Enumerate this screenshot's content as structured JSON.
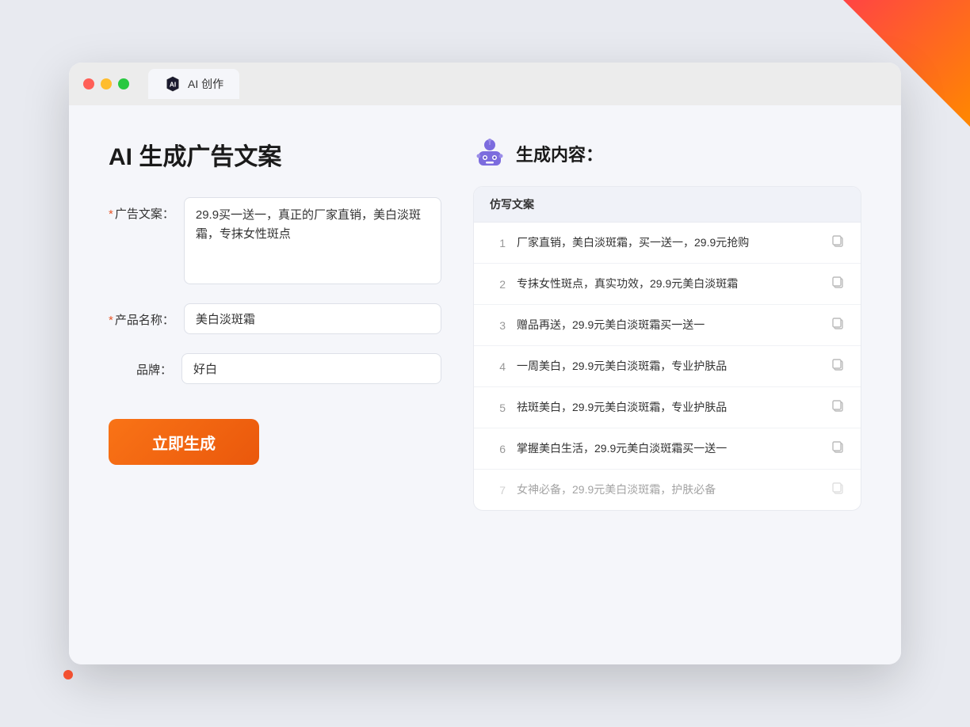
{
  "browser": {
    "tab_label": "AI 创作"
  },
  "page": {
    "title": "AI 生成广告文案",
    "result_title": "生成内容："
  },
  "form": {
    "ad_copy_label": "广告文案：",
    "ad_copy_required": "*",
    "ad_copy_value": "29.9买一送一，真正的厂家直销，美白淡斑霜，专抹女性斑点",
    "product_name_label": "产品名称：",
    "product_name_required": "*",
    "product_name_value": "美白淡斑霜",
    "brand_label": "品牌：",
    "brand_value": "好白",
    "generate_btn_label": "立即生成"
  },
  "result": {
    "table_header": "仿写文案",
    "rows": [
      {
        "number": "1",
        "text": "厂家直销，美白淡斑霜，买一送一，29.9元抢购",
        "dimmed": false
      },
      {
        "number": "2",
        "text": "专抹女性斑点，真实功效，29.9元美白淡斑霜",
        "dimmed": false
      },
      {
        "number": "3",
        "text": "赠品再送，29.9元美白淡斑霜买一送一",
        "dimmed": false
      },
      {
        "number": "4",
        "text": "一周美白，29.9元美白淡斑霜，专业护肤品",
        "dimmed": false
      },
      {
        "number": "5",
        "text": "祛斑美白，29.9元美白淡斑霜，专业护肤品",
        "dimmed": false
      },
      {
        "number": "6",
        "text": "掌握美白生活，29.9元美白淡斑霜买一送一",
        "dimmed": false
      },
      {
        "number": "7",
        "text": "女神必备，29.9元美白淡斑霜，护肤必备",
        "dimmed": true
      }
    ]
  }
}
